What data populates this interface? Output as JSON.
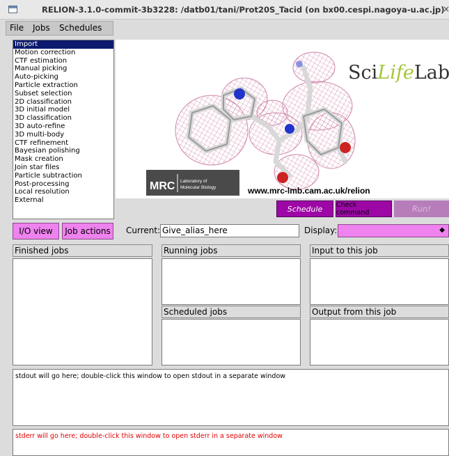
{
  "window": {
    "title": "RELION-3.1.0-commit-3b3228: /datb01/tani/Prot20S_Tacid (on bx00.cespi.nagoya-u.ac.jp)",
    "minimize": "_",
    "close": "×"
  },
  "menu": [
    "File",
    "Jobs",
    "Schedules"
  ],
  "job_types": [
    "Import",
    "Motion correction",
    "CTF estimation",
    "Manual picking",
    "Auto-picking",
    "Particle extraction",
    "Subset selection",
    "2D classification",
    "3D initial model",
    "3D classification",
    "3D auto-refine",
    "3D multi-body",
    "CTF refinement",
    "Bayesian polishing",
    "Mask creation",
    "Join star files",
    "Particle subtraction",
    "Post-processing",
    "Local resolution",
    "External"
  ],
  "selected_job_type": "Import",
  "banner": {
    "scilifelab_a": "Sci",
    "scilifelab_b": "Life",
    "scilifelab_c": "Lab",
    "mrc_logo": "MRC",
    "mrc_line1": "Laboratory of",
    "mrc_line2": "Molecular Biology",
    "url": "www.mrc-lmb.cam.ac.uk/relion"
  },
  "actions": {
    "schedule": "Schedule",
    "check_command": "Check command",
    "run": "Run!"
  },
  "controls": {
    "io_view": "I/O view",
    "job_actions": "Job actions",
    "current_label": "Current:",
    "alias_value": "Give_alias_here",
    "display_label": "Display:",
    "display_value": "",
    "dropdown_arrow": "◆"
  },
  "panels": {
    "finished": "Finished jobs",
    "running": "Running jobs",
    "scheduled": "Scheduled jobs",
    "input": "Input to this job",
    "output": "Output from this job"
  },
  "stdout": "stdout will go here; double-click this window to open stdout in a separate window",
  "stderr": "stderr will go here; double-click this window to open stderr in a separate window",
  "colors": {
    "schedule_btn": "#9d07a6",
    "run_btn_disabled": "#b77dbb",
    "pink_btn": "#ee82ee",
    "selection": "#0b1a6e",
    "stderr_text": "#e00000"
  }
}
